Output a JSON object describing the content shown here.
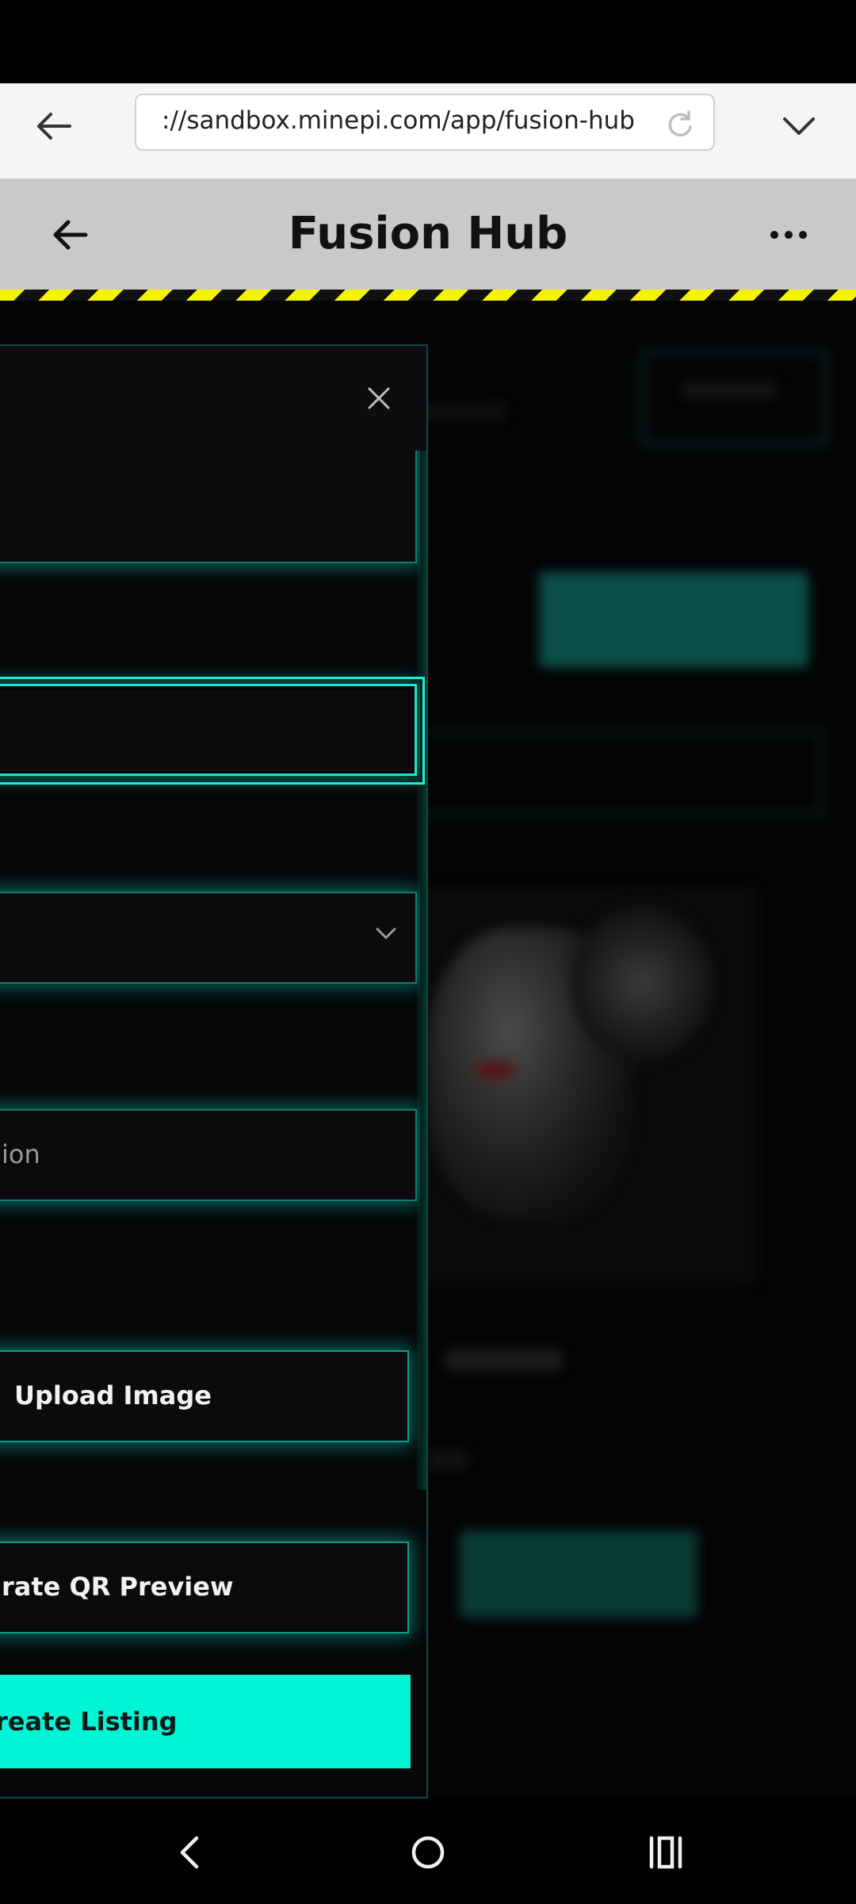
{
  "browser": {
    "url": "://sandbox.minepi.com/app/fusion-hub",
    "icons": [
      "back-arrow-icon",
      "reload-icon",
      "chevron-down-icon"
    ]
  },
  "app_header": {
    "title": "Fusion Hub",
    "icons": [
      "back-arrow-icon",
      "more-options-icon"
    ]
  },
  "modal": {
    "close_icon": "close-icon",
    "fields": [
      {
        "name": "field-1",
        "value": ""
      },
      {
        "name": "field-2-focused",
        "value": ""
      },
      {
        "name": "select-field",
        "value": "",
        "icon": "chevron-down-icon"
      },
      {
        "name": "description-field",
        "placeholder": "ion"
      }
    ],
    "upload_button": "Upload Image",
    "qr_button": "rate QR Preview",
    "create_button": "reate Listing"
  },
  "nav_bar": {
    "icons": [
      "nav-back-icon",
      "nav-home-icon",
      "nav-recents-icon"
    ]
  },
  "colors": {
    "accent": "#00f5d4",
    "modal_bg": "#060607",
    "header_bg": "#c9c9c9",
    "hazard_yellow": "#f4f400"
  }
}
